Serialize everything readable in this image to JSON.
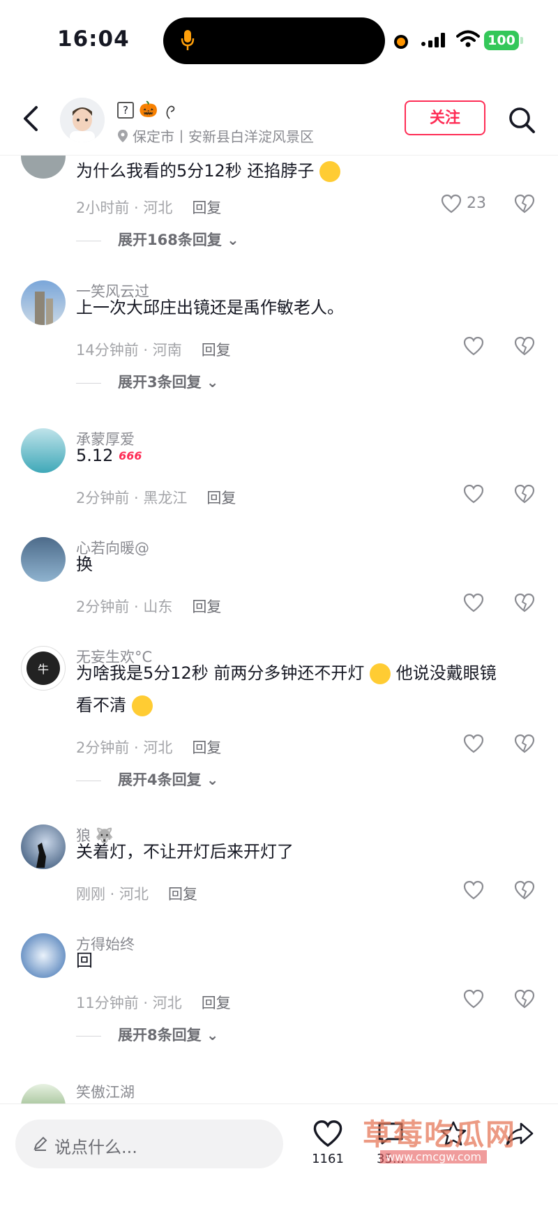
{
  "status_bar": {
    "time": "16:04",
    "battery": "100"
  },
  "header": {
    "user_name_suffix": "🎃",
    "location": "保定市丨安新县白洋淀风景区",
    "follow_label": "关注"
  },
  "comments": [
    {
      "name": "",
      "text": "为什么我看的5分12秒 还掐脖子",
      "meta": "2小时前 · 河北",
      "reply": "回复",
      "likes": "23",
      "expand": "展开168条回复"
    },
    {
      "name": "一笑风云过",
      "text": "上一次大邱庄出镜还是禹作敏老人。",
      "meta": "14分钟前 · 河南",
      "reply": "回复",
      "likes": "",
      "expand": "展开3条回复"
    },
    {
      "name": "承蒙厚爱",
      "text": "5.12",
      "meta": "2分钟前 · 黑龙江",
      "reply": "回复",
      "likes": ""
    },
    {
      "name": "心若向暖@",
      "text": "换",
      "meta": "2分钟前 · 山东",
      "reply": "回复",
      "likes": ""
    },
    {
      "name": "无妄生欢°C",
      "text_line1": "为啥我是5分12秒 前两分多钟还不开灯",
      "text_line1b": "他说没戴眼镜",
      "text_line2": "看不清",
      "meta": "2分钟前 · 河北",
      "reply": "回复",
      "likes": "",
      "expand": "展开4条回复"
    },
    {
      "name": "狼",
      "text": "关着灯，不让开灯后来开灯了",
      "meta": "刚刚 · 河北",
      "reply": "回复",
      "likes": ""
    },
    {
      "name": "方得始终",
      "text": "回",
      "meta": "11分钟前 · 河北",
      "reply": "回复",
      "likes": "",
      "expand": "展开8条回复"
    },
    {
      "name": "笑傲江湖"
    }
  ],
  "emoji_666": "666",
  "bottom_bar": {
    "input_placeholder": "说点什么...",
    "like_count": "1161",
    "comment_count": "35..."
  },
  "watermark": {
    "title": "草莓吃瓜网",
    "url": "www.cmcgw.com"
  },
  "colors": {
    "accent": "#fe2c55",
    "text": "#161823",
    "muted": "#8a8b91"
  }
}
